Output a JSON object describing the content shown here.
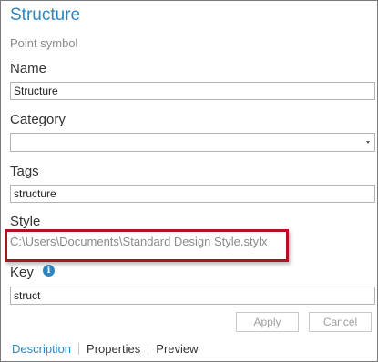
{
  "header": {
    "title": "Structure",
    "subtitle": "Point symbol"
  },
  "fields": {
    "name_label": "Name",
    "name_value": "Structure",
    "category_label": "Category",
    "category_value": "",
    "tags_label": "Tags",
    "tags_value": "structure",
    "style_label": "Style",
    "style_path": "C:\\Users\\Documents\\Standard Design Style.stylx",
    "key_label": "Key",
    "key_value": "struct"
  },
  "icons": {
    "info": "i"
  },
  "buttons": {
    "apply": "Apply",
    "cancel": "Cancel"
  },
  "tabs": [
    "Description",
    "Properties",
    "Preview"
  ],
  "colors": {
    "accent": "#2e86c1",
    "highlight": "#b01020"
  }
}
